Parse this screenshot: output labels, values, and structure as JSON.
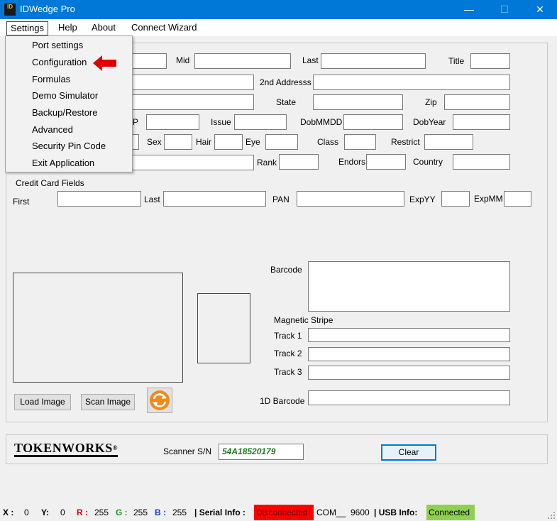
{
  "window": {
    "title": "IDWedge Pro",
    "icon_text": "ID",
    "minimize_glyph": "—",
    "maximize_glyph": "☐",
    "close_glyph": "✕"
  },
  "menu": {
    "settings": "Settings",
    "help": "Help",
    "about": "About",
    "connect_wizard": "Connect Wizard"
  },
  "settings_menu_items": [
    "Port settings",
    "Configuration",
    "Formulas",
    "Demo Simulator",
    "Backup/Restore",
    "Advanced",
    "Security Pin Code",
    "Exit Application"
  ],
  "fields": {
    "mid": "Mid",
    "last": "Last",
    "title": "Title",
    "address2": "2nd Addresss",
    "state": "State",
    "zip": "Zip",
    "p_partial": "P",
    "issue": "Issue",
    "dobmmdd": "DobMMDD",
    "dobyear": "DobYear",
    "sex": "Sex",
    "hair": "Hair",
    "eye": "Eye",
    "class": "Class",
    "restrict": "Restrict",
    "rank": "Rank",
    "endors": "Endors",
    "country": "Country"
  },
  "credit_card": {
    "group_label": "Credit Card Fields",
    "first": "First",
    "last": "Last",
    "pan": "PAN",
    "expyy": "ExpYY",
    "expmm": "ExpMM"
  },
  "scan_area": {
    "barcode": "Barcode",
    "magnetic_stripe": "Magnetic Stripe",
    "track1": "Track 1",
    "track2": "Track 2",
    "track3": "Track 3",
    "barcode_1d": "1D Barcode",
    "load_image": "Load Image",
    "scan_image": "Scan Image"
  },
  "bottom": {
    "logo_text": "TOKENWORKS",
    "logo_mark": "®",
    "scanner_sn_label": "Scanner S/N",
    "scanner_sn_value": "54A18520179",
    "clear": "Clear"
  },
  "status": {
    "x_label": "X :",
    "x_value": "0",
    "y_label": "Y:",
    "y_value": "0",
    "r_label": "R :",
    "r_value": "255",
    "g_label": "G :",
    "g_value": "255",
    "b_label": "B :",
    "b_value": "255",
    "serial_label": "| Serial Info :",
    "serial_value": "Disconnected",
    "com_port": "COM__",
    "baud": "9600",
    "usb_label": "| USB Info:",
    "usb_value": "Connected"
  },
  "colors": {
    "titlebar": "#0078d7",
    "serial_status_bg": "#ff0000",
    "usb_status_bg": "#8fd14f",
    "scanner_sn_text": "#1e7b1e",
    "arrow": "#e00000",
    "red_label": "#e00000",
    "green_label": "#1a9e1a",
    "blue_label": "#1a3ed8"
  },
  "icons": [
    "app-icon",
    "refresh-icon",
    "red-arrow-pointer",
    "resize-grip-icon"
  ]
}
